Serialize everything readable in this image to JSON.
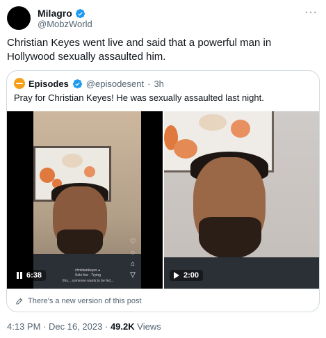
{
  "author": {
    "display_name": "Milagro",
    "handle": "@MobzWorld",
    "more_label": "···"
  },
  "tweet": {
    "text": "Christian Keyes went live and said that a powerful man in Hollywood sexually assaulted him."
  },
  "quote": {
    "display_name": "Episodes",
    "handle": "@episodesent",
    "separator": "·",
    "time": "3h",
    "text": "Pray for Christian Keyes! He was sexually assaulted last night.",
    "videos": [
      {
        "duration": "6:38",
        "state": "paused",
        "overlay_line1": "christiankeyes ●",
        "overlay_line2": "Solo live · Trying",
        "overlay_line3": "this... someone wants to be fed..."
      },
      {
        "duration": "2:00",
        "state": "play"
      }
    ],
    "footer_note": "There's a new version of this post"
  },
  "meta": {
    "time": "4:13 PM",
    "dot": "·",
    "date": "Dec 16, 2023",
    "views_count": "49.2K",
    "views_label": "Views"
  },
  "colors": {
    "verified_blue": "#1d9bf0",
    "quote_avatar": "#f4a01b",
    "secondary_text": "#536471"
  }
}
